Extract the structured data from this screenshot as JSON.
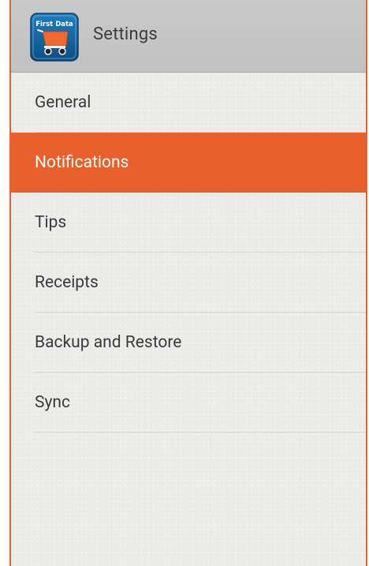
{
  "header": {
    "title": "Settings",
    "app_icon": "first-data-app-icon",
    "app_icon_text": "First Data"
  },
  "menu": {
    "items": [
      {
        "label": "General",
        "selected": false
      },
      {
        "label": "Notifications",
        "selected": true
      },
      {
        "label": "Tips",
        "selected": false
      },
      {
        "label": "Receipts",
        "selected": false
      },
      {
        "label": "Backup and Restore",
        "selected": false
      },
      {
        "label": "Sync",
        "selected": false
      }
    ]
  },
  "colors": {
    "accent": "#e8612c",
    "actionbar": "#c4c4c4",
    "background": "#ececea"
  }
}
